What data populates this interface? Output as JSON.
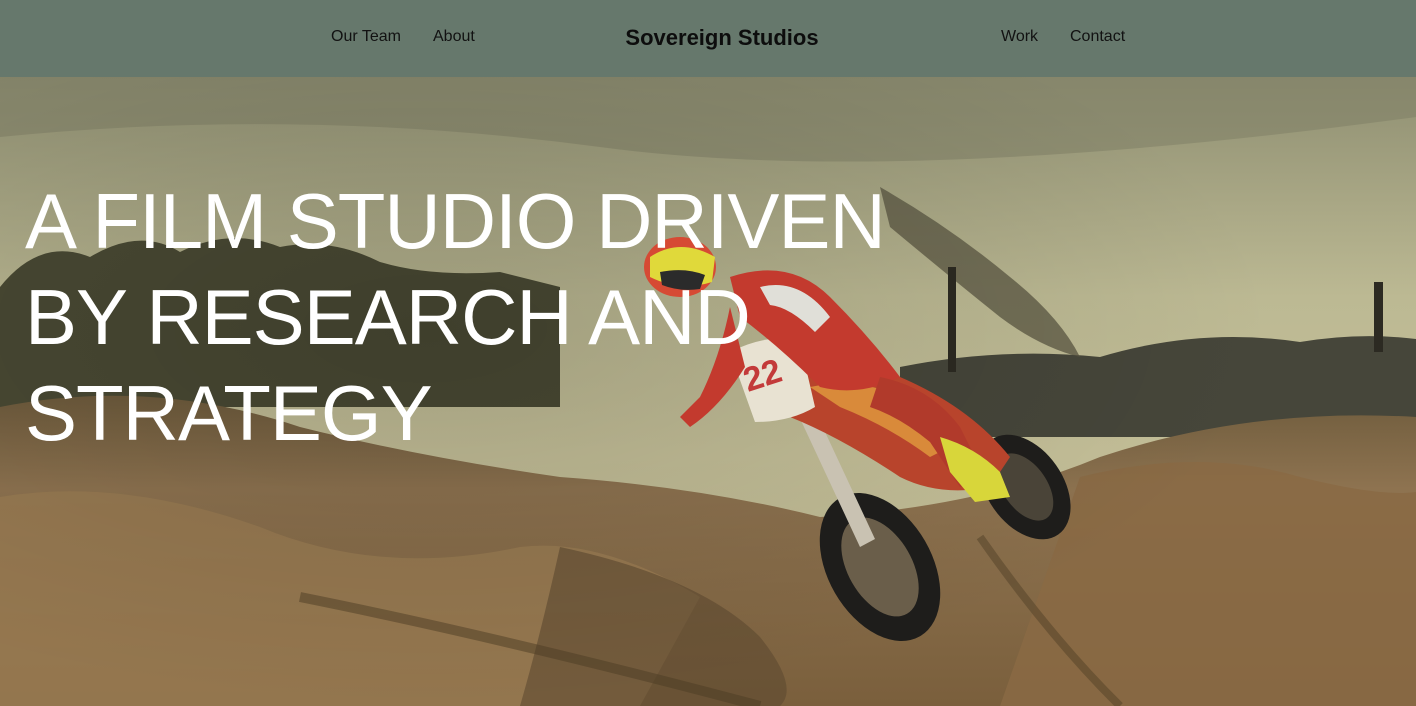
{
  "nav": {
    "left_links": [
      "Our Team",
      "About"
    ],
    "brand": "Sovereign Studios",
    "right_links": [
      "Work",
      "Contact"
    ],
    "background_color": "#66786c"
  },
  "hero": {
    "headline_lines": [
      "A FILM STUDIO DRIVEN",
      "BY RESEARCH AND",
      "STRATEGY"
    ],
    "image_subject": "motocross rider on dirt track",
    "text_color": "#ffffff"
  }
}
